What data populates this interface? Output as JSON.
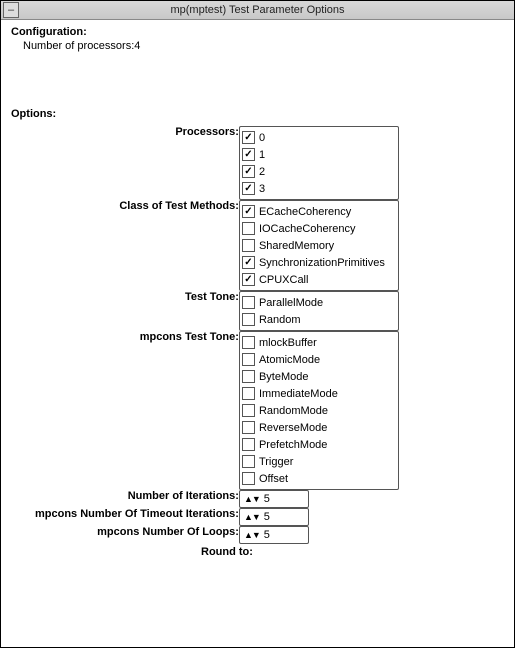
{
  "title": "mp(mptest) Test Parameter Options",
  "config_label": "Configuration:",
  "config_value": "Number of processors:4",
  "options_label": "Options:",
  "rows": {
    "processors": {
      "label": "Processors:",
      "items": [
        {
          "label": "0",
          "checked": true
        },
        {
          "label": "1",
          "checked": true
        },
        {
          "label": "2",
          "checked": true
        },
        {
          "label": "3",
          "checked": true
        }
      ]
    },
    "class_methods": {
      "label": "Class of Test Methods:",
      "items": [
        {
          "label": "ECacheCoherency",
          "checked": true
        },
        {
          "label": "IOCacheCoherency",
          "checked": false
        },
        {
          "label": "SharedMemory",
          "checked": false
        },
        {
          "label": "SynchronizationPrimitives",
          "checked": true
        },
        {
          "label": "CPUXCall",
          "checked": true
        }
      ]
    },
    "test_tone": {
      "label": "Test Tone:",
      "items": [
        {
          "label": "ParallelMode",
          "checked": false
        },
        {
          "label": "Random",
          "checked": false
        }
      ]
    },
    "mpcons_test_tone": {
      "label": "mpcons Test Tone:",
      "items": [
        {
          "label": "mlockBuffer",
          "checked": false
        },
        {
          "label": "AtomicMode",
          "checked": false
        },
        {
          "label": "ByteMode",
          "checked": false
        },
        {
          "label": "ImmediateMode",
          "checked": false
        },
        {
          "label": "RandomMode",
          "checked": false
        },
        {
          "label": "ReverseMode",
          "checked": false
        },
        {
          "label": "PrefetchMode",
          "checked": false
        },
        {
          "label": "Trigger",
          "checked": false
        },
        {
          "label": "Offset",
          "checked": false
        }
      ]
    },
    "num_iterations": {
      "label": "Number of Iterations:",
      "value": "5"
    },
    "mpcons_timeout": {
      "label": "mpcons Number Of Timeout Iterations:",
      "value": "5"
    },
    "mpcons_loops": {
      "label": "mpcons Number Of Loops:",
      "value": "5"
    }
  },
  "round_to": "Round to:"
}
